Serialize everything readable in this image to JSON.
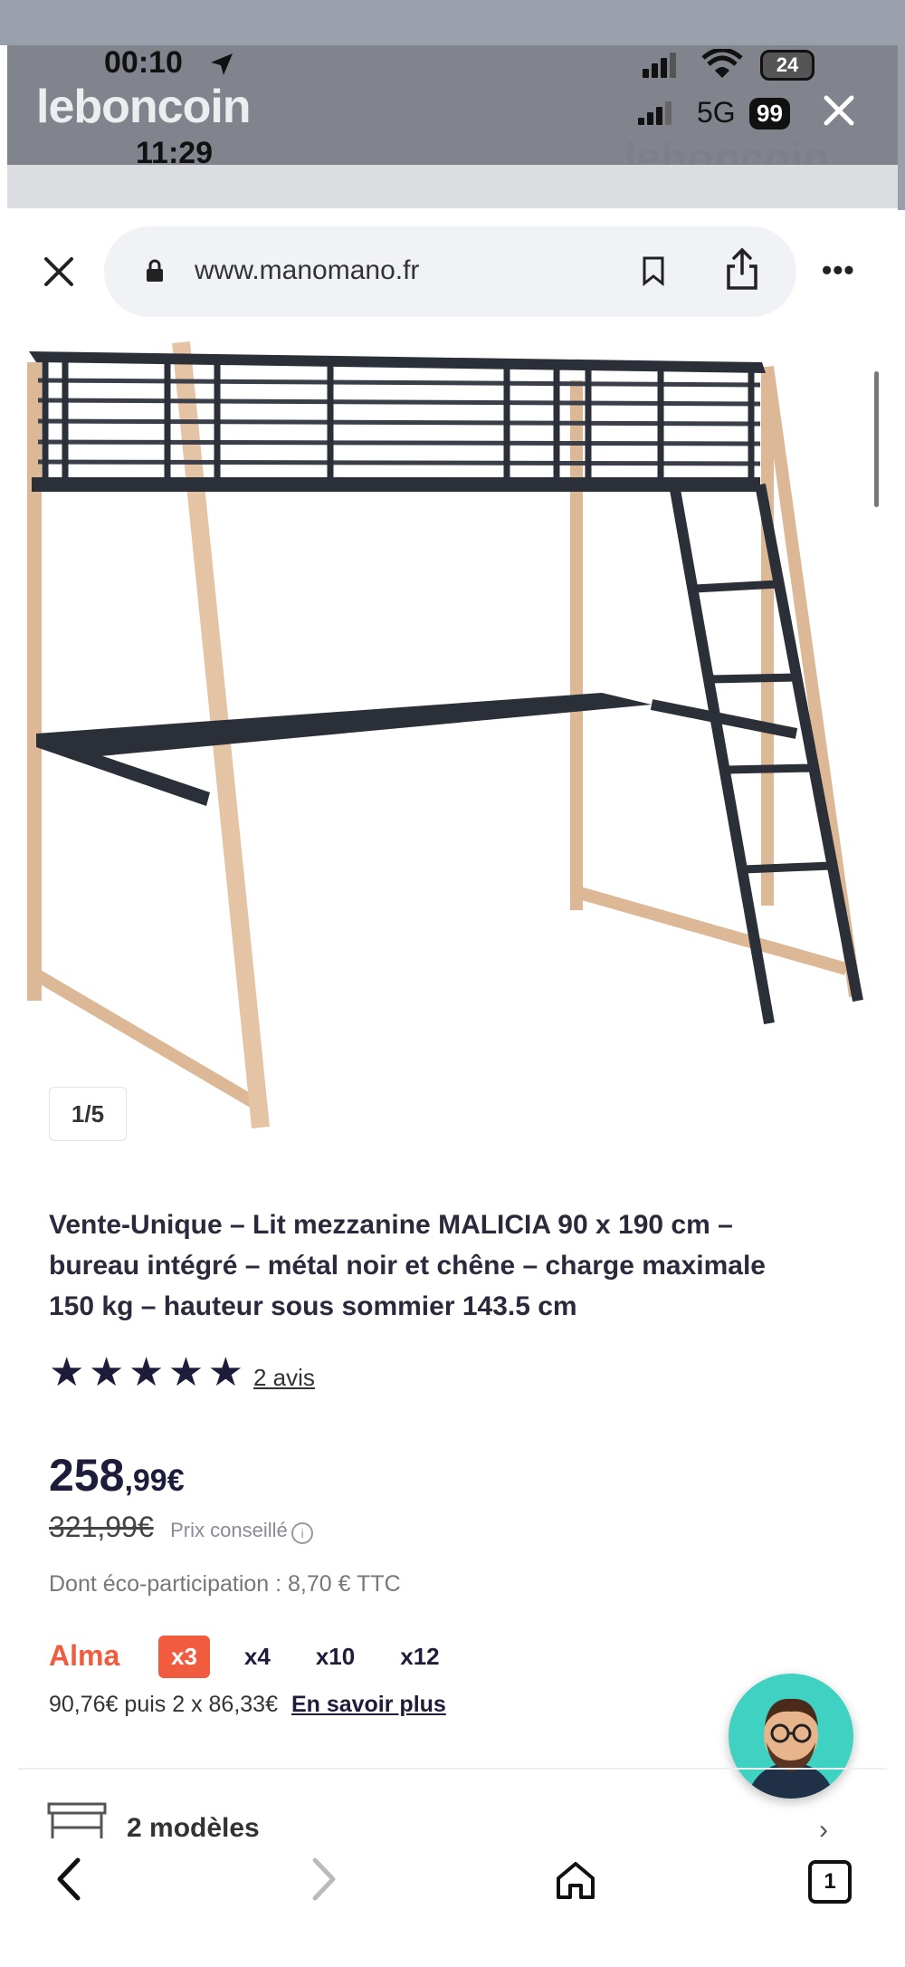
{
  "status_bar": {
    "time": "00:10",
    "battery": "24"
  },
  "overlay": {
    "brand": "leboncoin",
    "time": "11:29",
    "network": "5G",
    "battery": "99",
    "watermark": "leboncoin"
  },
  "browser": {
    "url": "www.manomano.fr"
  },
  "gallery": {
    "counter": "1/5"
  },
  "product": {
    "title_line1": "Vente-Unique – Lit mezzanine MALICIA 90 x 190 cm –",
    "title_line2": "bureau intégré – métal noir et chêne – charge maximale",
    "title_line3": "150 kg – hauteur sous sommier 143.5 cm",
    "rating": 5,
    "reviews_link": "2 avis",
    "price_main": "258",
    "price_cents": ",99€",
    "old_price": "321,99€",
    "old_price_label": "Prix conseillé",
    "eco_participation": "Dont éco-participation : 8,70 € TTC",
    "alma_label": "Alma",
    "installments": [
      "x3",
      "x4",
      "x10",
      "x12"
    ],
    "installment_selected": 0,
    "installment_detail": "90,76€ puis 2 x 86,33€",
    "learn_more": "En savoir plus",
    "models": "2 modèles"
  },
  "colors": {
    "brand_dark": "#1d1d3b",
    "alma_orange": "#f25c3e",
    "avatar_teal": "#3fd1c1"
  }
}
